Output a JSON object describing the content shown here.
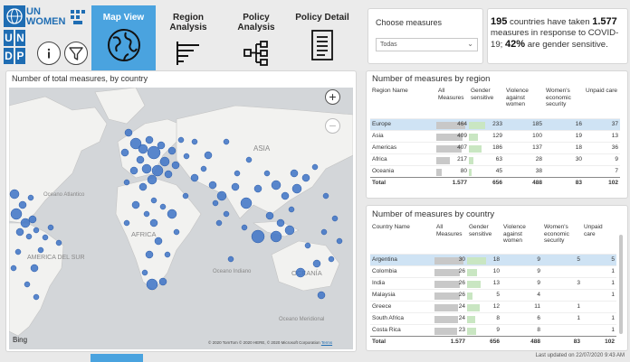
{
  "logo": {
    "undp_letters": [
      "U",
      "N",
      "D",
      "P"
    ],
    "un_women": "UN\nWOMEN"
  },
  "nav": {
    "tabs": [
      {
        "label": "Map View",
        "icon": "globe-icon",
        "active": true
      },
      {
        "label": "Region\nAnalysis",
        "icon": "bars-icon",
        "active": false
      },
      {
        "label": "Policy\nAnalysis",
        "icon": "hierarchy-icon",
        "active": false
      },
      {
        "label": "Policy Detail",
        "icon": "document-icon",
        "active": false
      }
    ]
  },
  "filter": {
    "title": "Choose measures",
    "selected": "Todas"
  },
  "statement": {
    "countries": "195",
    "text1": " countries have taken ",
    "measures": "1.577",
    "text2": " measures in response to COVID-19; ",
    "percent": "42%",
    "text3": " are gender sensitive."
  },
  "map": {
    "title": "Number of total measures, by country",
    "labels": [
      "ASIA",
      "Oceano Atlantico",
      "AMERICA DEL SUR",
      "AFRICA",
      "OCEANÍA",
      "Oceano Indiano",
      "Oceano Meridional"
    ],
    "attribution": "© 2020 TomTom © 2020 HERE, © 2020 Microsoft Corporation",
    "terms": "Terms",
    "bing": "Bing",
    "zoom_in": "+",
    "zoom_out": "−"
  },
  "region_table": {
    "title": "Number of measures by region",
    "headers": [
      "Region Name",
      "All Measures",
      "Gender sensitive",
      "Violence against women",
      "Women's economic security",
      "Unpaid care"
    ],
    "rows": [
      {
        "name": "Europe",
        "all": "464",
        "gender": "233",
        "violence": "185",
        "economic": "16",
        "unpaid": "37",
        "all_v": 464,
        "gender_v": 233,
        "selected": true
      },
      {
        "name": "Asia",
        "all": "409",
        "gender": "129",
        "violence": "100",
        "economic": "19",
        "unpaid": "13",
        "all_v": 409,
        "gender_v": 129
      },
      {
        "name": "Americas",
        "all": "407",
        "gender": "186",
        "violence": "137",
        "economic": "18",
        "unpaid": "36",
        "all_v": 407,
        "gender_v": 186
      },
      {
        "name": "Africa",
        "all": "217",
        "gender": "63",
        "violence": "28",
        "economic": "30",
        "unpaid": "9",
        "all_v": 217,
        "gender_v": 63
      },
      {
        "name": "Oceania",
        "all": "80",
        "gender": "45",
        "violence": "38",
        "economic": "",
        "unpaid": "7",
        "all_v": 80,
        "gender_v": 45
      }
    ],
    "total": {
      "name": "Total",
      "all": "1.577",
      "gender": "656",
      "violence": "488",
      "economic": "83",
      "unpaid": "102"
    }
  },
  "country_table": {
    "title": "Number of measures by country",
    "headers": [
      "Country Name",
      "All Measures",
      "Gender sensitive",
      "Violence against women",
      "Women's economic security",
      "Unpaid care"
    ],
    "rows": [
      {
        "name": "Argentina",
        "all": "30",
        "gender": "18",
        "violence": "9",
        "economic": "5",
        "unpaid": "5",
        "all_v": 30,
        "gender_v": 18,
        "selected": true
      },
      {
        "name": "Colombia",
        "all": "26",
        "gender": "10",
        "violence": "9",
        "economic": "",
        "unpaid": "1",
        "all_v": 26,
        "gender_v": 10
      },
      {
        "name": "India",
        "all": "26",
        "gender": "13",
        "violence": "9",
        "economic": "3",
        "unpaid": "1",
        "all_v": 26,
        "gender_v": 13
      },
      {
        "name": "Malaysia",
        "all": "26",
        "gender": "5",
        "violence": "4",
        "economic": "",
        "unpaid": "1",
        "all_v": 26,
        "gender_v": 5
      },
      {
        "name": "Greece",
        "all": "24",
        "gender": "12",
        "violence": "11",
        "economic": "1",
        "unpaid": "",
        "all_v": 24,
        "gender_v": 12
      },
      {
        "name": "South Africa",
        "all": "24",
        "gender": "8",
        "violence": "6",
        "economic": "1",
        "unpaid": "1",
        "all_v": 24,
        "gender_v": 8
      },
      {
        "name": "Costa Rica",
        "all": "23",
        "gender": "9",
        "violence": "8",
        "economic": "",
        "unpaid": "1",
        "all_v": 23,
        "gender_v": 9
      }
    ],
    "total": {
      "name": "Total",
      "all": "1.577",
      "gender": "656",
      "violence": "488",
      "economic": "83",
      "unpaid": "102"
    }
  },
  "footer": "Last updated on 22/07/2020 9:43 AM",
  "colors": {
    "accent": "#4aa3df",
    "undp_blue": "#1f6db3",
    "bar_all": "#c8c8c8",
    "bar_gender": "#c9e6c2",
    "bubble": "#3d73c6"
  }
}
